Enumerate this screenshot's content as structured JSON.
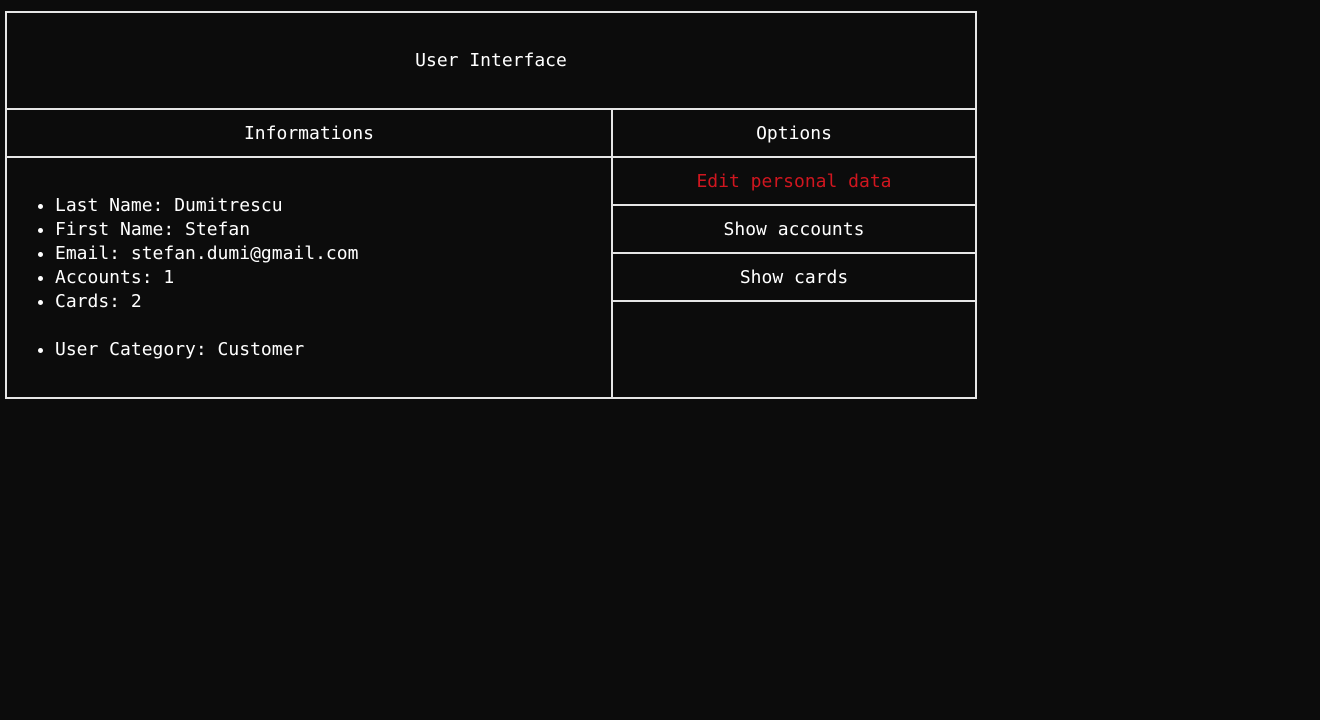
{
  "title": "User Interface",
  "info": {
    "header": "Informations",
    "items": [
      "Last Name: Dumitrescu",
      "First Name: Stefan",
      "Email: stefan.dumi@gmail.com",
      "Accounts: 1",
      "Cards: 2"
    ],
    "category": "User Category: Customer"
  },
  "options": {
    "header": "Options",
    "items": [
      "Edit personal data",
      "Show accounts",
      "Show cards"
    ]
  },
  "colors": {
    "background": "#0c0c0c",
    "border": "#e6e6e6",
    "text": "#ffffff",
    "active_option": "#d0161f"
  }
}
